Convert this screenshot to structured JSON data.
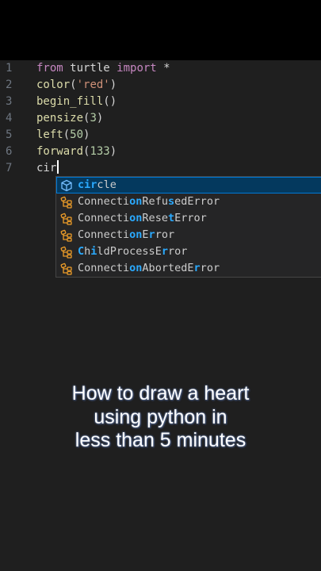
{
  "editor": {
    "lines": [
      {
        "number": "1",
        "parts": [
          {
            "text": "from",
            "cls": "kw"
          },
          {
            "text": " turtle ",
            "cls": "pl"
          },
          {
            "text": "import",
            "cls": "kw"
          },
          {
            "text": " *",
            "cls": "pl"
          }
        ]
      },
      {
        "number": "2",
        "parts": [
          {
            "text": "color",
            "cls": "fn"
          },
          {
            "text": "(",
            "cls": "pl"
          },
          {
            "text": "'red'",
            "cls": "str"
          },
          {
            "text": ")",
            "cls": "pl"
          }
        ]
      },
      {
        "number": "3",
        "parts": [
          {
            "text": "begin_fill",
            "cls": "fn"
          },
          {
            "text": "()",
            "cls": "pl"
          }
        ]
      },
      {
        "number": "4",
        "parts": [
          {
            "text": "pensize",
            "cls": "fn"
          },
          {
            "text": "(",
            "cls": "pl"
          },
          {
            "text": "3",
            "cls": "num"
          },
          {
            "text": ")",
            "cls": "pl"
          }
        ]
      },
      {
        "number": "5",
        "parts": [
          {
            "text": "left",
            "cls": "fn"
          },
          {
            "text": "(",
            "cls": "pl"
          },
          {
            "text": "50",
            "cls": "num"
          },
          {
            "text": ")",
            "cls": "pl"
          }
        ]
      },
      {
        "number": "6",
        "parts": [
          {
            "text": "forward",
            "cls": "fn"
          },
          {
            "text": "(",
            "cls": "pl"
          },
          {
            "text": "133",
            "cls": "num"
          },
          {
            "text": ")",
            "cls": "pl"
          }
        ]
      },
      {
        "number": "7",
        "parts": [
          {
            "text": "cir",
            "cls": "pl"
          }
        ],
        "cursor": true
      }
    ]
  },
  "suggestions": {
    "items": [
      {
        "label": "circle",
        "match": [
          0,
          3
        ],
        "icon": "cube-method-icon",
        "selected": true
      },
      {
        "label": "ConnectionRefusedError",
        "match": [
          8,
          9,
          14
        ],
        "icon": "class-icon",
        "selected": false
      },
      {
        "label": "ConnectionResetError",
        "match": [
          8,
          9,
          14
        ],
        "icon": "class-icon",
        "selected": false
      },
      {
        "label": "ConnectionError",
        "match": [
          8,
          9,
          11
        ],
        "icon": "class-icon",
        "selected": false
      },
      {
        "label": "ChildProcessError",
        "match": [
          0,
          2,
          13
        ],
        "icon": "class-icon",
        "selected": false
      },
      {
        "label": "ConnectionAbortedError",
        "match": [
          8,
          9,
          18
        ],
        "icon": "class-icon",
        "selected": false
      }
    ]
  },
  "caption": {
    "lines": [
      "How to draw a heart",
      "using python in",
      "less than 5 minutes"
    ]
  },
  "colors": {
    "background": "#1f1f1f",
    "keyword": "#c586c0",
    "string": "#ce9178",
    "number": "#b5cea8",
    "function": "#dcdcaa",
    "match_highlight": "#2aaaff",
    "class_icon": "#ee9d28",
    "method_icon": "#75beff"
  }
}
